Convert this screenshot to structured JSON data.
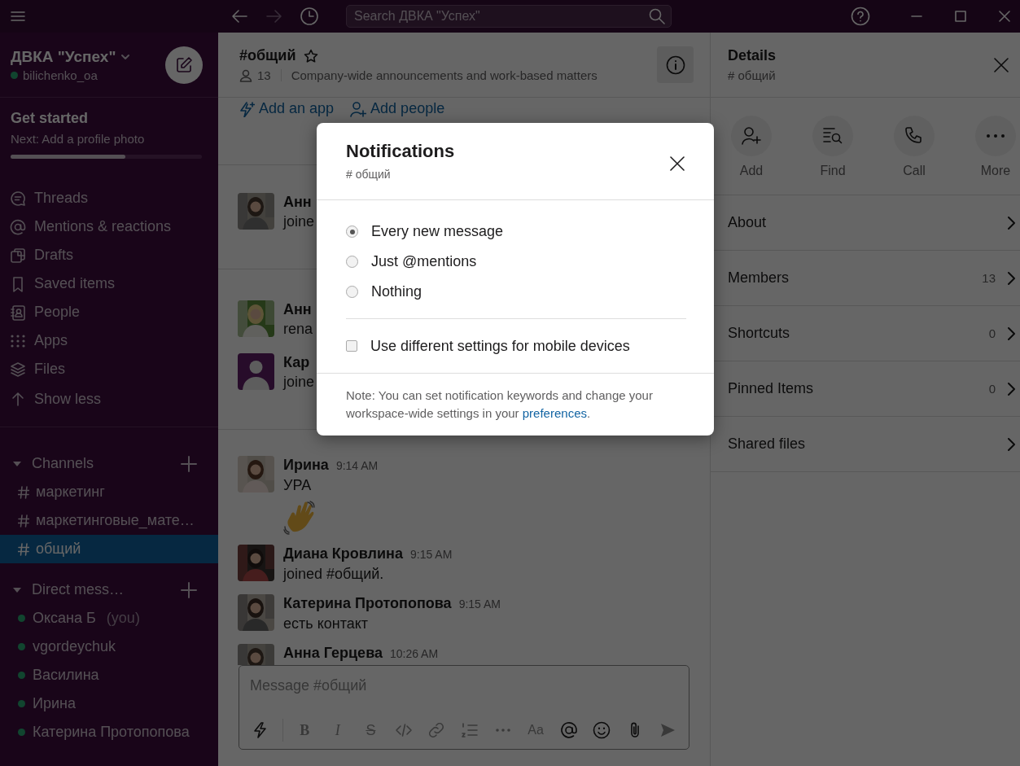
{
  "title_bar": {
    "nav": [
      {
        "kind": "back",
        "disabled": false
      },
      {
        "kind": "forward",
        "disabled": true
      },
      {
        "kind": "history",
        "disabled": false
      }
    ],
    "search": {
      "placeholder": "Search ДВКА \"Успех\""
    }
  },
  "workspace": {
    "name": "ДВКА \"Успех\"",
    "user": "bilichenko_oa",
    "online": true
  },
  "onboarding": {
    "title": "Get started",
    "next": "Next: Add a profile photo",
    "level": 0.6
  },
  "sidebar_nav": [
    {
      "kind": "threads",
      "label": "Threads"
    },
    {
      "kind": "mentions",
      "label": "Mentions & reactions"
    },
    {
      "kind": "drafts",
      "label": "Drafts"
    },
    {
      "kind": "saved",
      "label": "Saved items"
    },
    {
      "kind": "people",
      "label": "People"
    },
    {
      "kind": "apps",
      "label": "Apps"
    },
    {
      "kind": "files",
      "label": "Files"
    },
    {
      "kind": "show_less",
      "label": "Show less"
    }
  ],
  "channels_section": {
    "label": "Channels",
    "expanded": true,
    "channels": [
      {
        "name": "маркетинг",
        "selected": false
      },
      {
        "name": "маркетинговые_мате…",
        "selected": false
      },
      {
        "name": "общий",
        "selected": true
      }
    ]
  },
  "dm_section": {
    "label": "Direct mess…",
    "expanded": true,
    "people": [
      {
        "name": "Оксана Б",
        "note": "(you)",
        "online": true
      },
      {
        "name": "vgordeychuk",
        "online": true
      },
      {
        "name": "Василина",
        "online": true
      },
      {
        "name": "Ирина",
        "online": true
      },
      {
        "name": "Катерина Протопопова",
        "online": true
      }
    ]
  },
  "channel_header": {
    "name": "#общий",
    "starred": false,
    "members": "13",
    "topic": "Company-wide announcements and work-based matters"
  },
  "channel_actions": [
    {
      "kind": "add_app",
      "label": "Add an app"
    },
    {
      "kind": "add_people",
      "label": "Add people"
    }
  ],
  "message_groups": [
    {
      "messages": [
        {
          "author": "Анн",
          "avatar": {
            "kind": "picture"
          },
          "lines": [
            "joine"
          ]
        }
      ]
    },
    {
      "messages": [
        {
          "author": "Анн",
          "avatar": {
            "kind": "picture"
          },
          "lines": [
            "rena"
          ]
        },
        {
          "author": "Кар",
          "avatar": {
            "kind": "default"
          },
          "lines": [
            "joine"
          ]
        }
      ]
    },
    {
      "messages": [
        {
          "author": "Ирина",
          "time": "9:14 AM",
          "avatar": {
            "kind": "picture"
          },
          "lines": [
            "УРА"
          ],
          "attachment": {
            "kind": "wave"
          }
        },
        {
          "author": "Диана Кровлина",
          "time": "9:15 AM",
          "avatar": {
            "kind": "picture"
          },
          "lines": [
            "joined #общий."
          ]
        },
        {
          "author": "Катерина Протопопова",
          "time": "9:15 AM",
          "avatar": {
            "kind": "picture"
          },
          "lines": [
            "есть контакт"
          ]
        },
        {
          "author": "Анна Герцева",
          "time": "10:26 AM",
          "avatar": {
            "kind": "picture"
          }
        }
      ]
    }
  ],
  "composer": {
    "placeholder": "Message #общий",
    "toolbar": [
      {
        "kind": "shortcuts",
        "disabled": false
      },
      {
        "kind": "bold",
        "label": "B",
        "disabled": true
      },
      {
        "kind": "italic",
        "label": "I",
        "disabled": true
      },
      {
        "kind": "strike",
        "label": "S",
        "disabled": true
      },
      {
        "kind": "code",
        "disabled": true
      },
      {
        "kind": "link",
        "disabled": true
      },
      {
        "kind": "list",
        "disabled": true
      },
      {
        "kind": "more",
        "disabled": true
      },
      {
        "kind": "format",
        "label": "Aa",
        "disabled": true
      },
      {
        "kind": "mention",
        "disabled": false
      },
      {
        "kind": "emoji",
        "disabled": false
      },
      {
        "kind": "attach",
        "disabled": false
      },
      {
        "kind": "send",
        "disabled": true
      }
    ]
  },
  "details": {
    "title": "Details",
    "subtitle": "# общий",
    "actions": [
      {
        "kind": "add",
        "label": "Add"
      },
      {
        "kind": "find",
        "label": "Find"
      },
      {
        "kind": "call",
        "label": "Call"
      },
      {
        "kind": "more",
        "label": "More"
      }
    ],
    "rows": [
      {
        "label": "About"
      },
      {
        "label": "Members",
        "count": "13"
      },
      {
        "label": "Shortcuts",
        "count": "0"
      },
      {
        "label": "Pinned Items",
        "count": "0"
      },
      {
        "label": "Shared files"
      }
    ]
  },
  "dialog": {
    "title": "Notifications",
    "subtitle": "# общий",
    "options": [
      {
        "label": "Every new message",
        "selected": true
      },
      {
        "label": "Just @mentions",
        "selected": false
      },
      {
        "label": "Nothing",
        "selected": false
      }
    ],
    "mobile": {
      "label": "Use different settings for mobile devices",
      "checked": false
    },
    "note": {
      "text": "Note: You can set notification keywords and change your workspace-wide settings in your ",
      "link": "preferences",
      "end": "."
    }
  }
}
